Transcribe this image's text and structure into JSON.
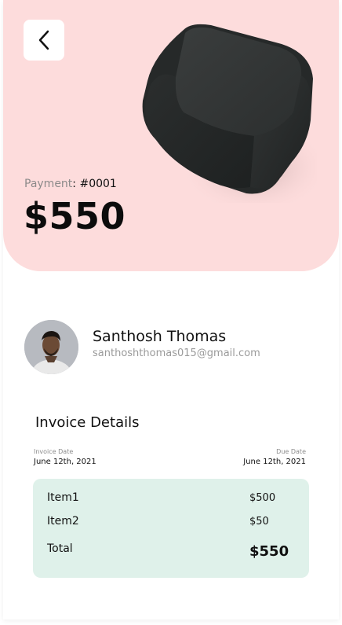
{
  "payment": {
    "label": "Payment",
    "colon": ":",
    "number": "#0001",
    "amount": "$550"
  },
  "customer": {
    "name": "Santhosh Thomas",
    "email": "santhoshthomas015@gmail.com"
  },
  "invoice": {
    "title": "Invoice Details",
    "invoice_date_label": "Invoice Date",
    "invoice_date": "June 12th, 2021",
    "due_date_label": "Due Date",
    "due_date": "June 12th, 2021",
    "items": [
      {
        "label": "Item1",
        "value": "$500"
      },
      {
        "label": "Item2",
        "value": "$50"
      }
    ],
    "total_label": "Total",
    "total_value": "$550"
  },
  "colors": {
    "hero_bg": "#fddcdc",
    "items_bg": "#dff1ea",
    "cube": "#2b2f2f"
  },
  "icons": {
    "back": "chevron-left-icon"
  }
}
